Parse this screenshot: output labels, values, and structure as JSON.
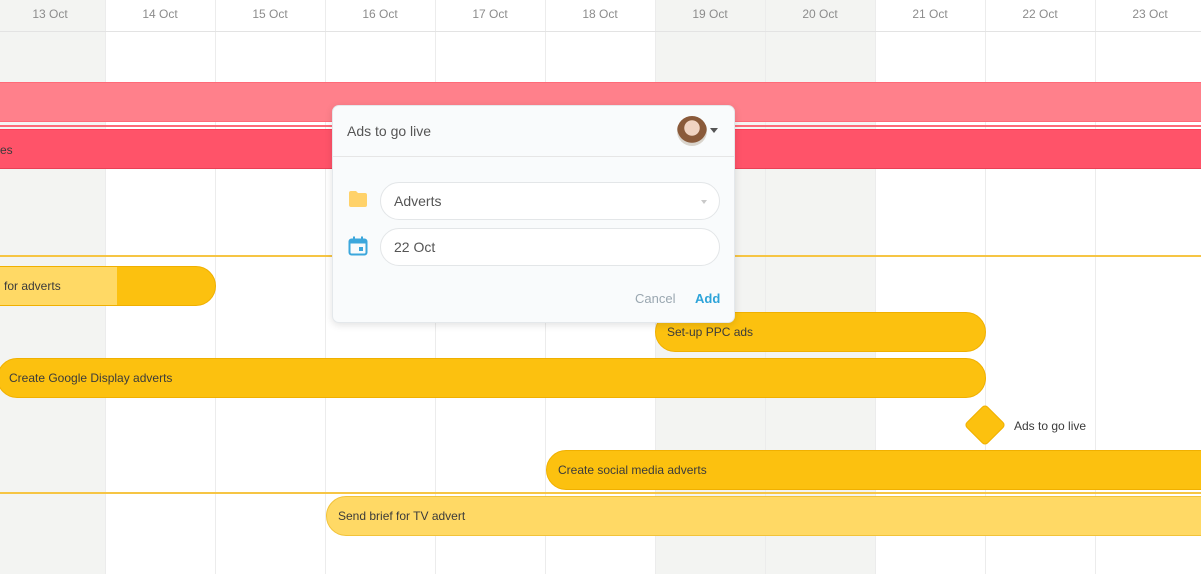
{
  "timeline": {
    "dates": [
      "13 Oct",
      "14 Oct",
      "15 Oct",
      "16 Oct",
      "17 Oct",
      "18 Oct",
      "19 Oct",
      "20 Oct",
      "21 Oct",
      "22 Oct",
      "23 Oct"
    ]
  },
  "tasks": {
    "red_bottom_label": "es",
    "adverts_research": "for adverts",
    "ppc": "Set-up PPC ads",
    "google_display": "Create Google Display adverts",
    "social_media": "Create social media adverts",
    "tv_brief": "Send brief for TV advert"
  },
  "milestone": {
    "label": "Ads to go live"
  },
  "popup": {
    "title": "Ads to go live",
    "project_value": "Adverts",
    "date_value": "22 Oct",
    "cancel_label": "Cancel",
    "add_label": "Add"
  },
  "colors": {
    "task_dark": "#fcc10f",
    "task_light": "#ffd965",
    "red_light": "#ff808b",
    "red_dark": "#ff5369",
    "accent": "#2ea4d9"
  },
  "icons": [
    "folder-icon",
    "calendar-icon",
    "chevron-down-icon"
  ]
}
